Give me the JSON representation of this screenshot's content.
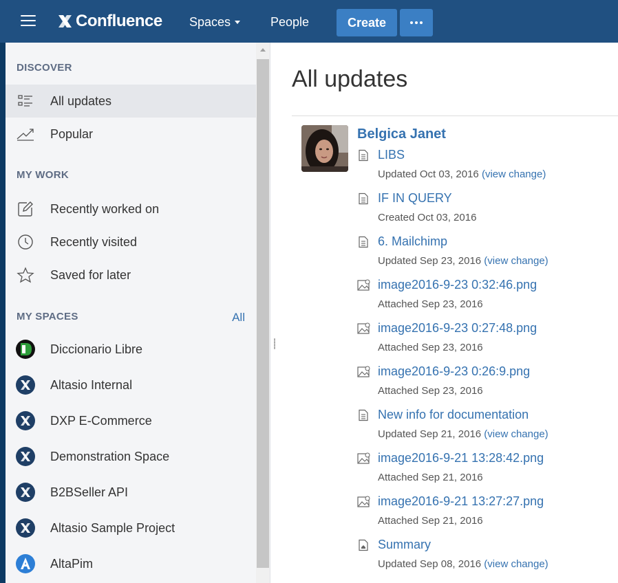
{
  "nav": {
    "logo_text": "Confluence",
    "spaces_label": "Spaces",
    "people_label": "People",
    "create_label": "Create",
    "more_icon": "ellipsis-icon",
    "colors": {
      "bar": "#205081",
      "button": "#3b7fc4"
    }
  },
  "sidebar": {
    "discover_heading": "DISCOVER",
    "discover": [
      {
        "label": "All updates",
        "icon": "list-icon",
        "active": true
      },
      {
        "label": "Popular",
        "icon": "trend-icon"
      }
    ],
    "mywork_heading": "MY WORK",
    "mywork": [
      {
        "label": "Recently worked on",
        "icon": "edit-icon"
      },
      {
        "label": "Recently visited",
        "icon": "clock-icon"
      },
      {
        "label": "Saved for later",
        "icon": "star-icon"
      }
    ],
    "myspaces_heading": "MY SPACES",
    "myspaces_all": "All",
    "spaces": [
      {
        "label": "Diccionario Libre",
        "icon": "diccionario-space-icon"
      },
      {
        "label": "Altasio Internal",
        "icon": "altasio-space-icon"
      },
      {
        "label": "DXP E-Commerce",
        "icon": "altasio-space-icon"
      },
      {
        "label": "Demonstration Space",
        "icon": "altasio-space-icon"
      },
      {
        "label": "B2BSeller API",
        "icon": "altasio-space-icon"
      },
      {
        "label": "Altasio Sample Project",
        "icon": "altasio-space-icon"
      },
      {
        "label": "AltaPim",
        "icon": "altapim-space-icon"
      }
    ]
  },
  "main": {
    "title": "All updates",
    "author": "Belgica Janet",
    "updates": [
      {
        "title": "LIBS",
        "type": "page",
        "action": "Updated Oct 03, 2016",
        "view_change": "(view change)"
      },
      {
        "title": "IF IN QUERY",
        "type": "page",
        "action": "Created Oct 03, 2016",
        "view_change": ""
      },
      {
        "title": "6. Mailchimp",
        "type": "page",
        "action": "Updated Sep 23, 2016",
        "view_change": "(view change)"
      },
      {
        "title": "image2016-9-23 0:32:46.png",
        "type": "image",
        "action": "Attached Sep 23, 2016",
        "view_change": ""
      },
      {
        "title": "image2016-9-23 0:27:48.png",
        "type": "image",
        "action": "Attached Sep 23, 2016",
        "view_change": ""
      },
      {
        "title": "image2016-9-23 0:26:9.png",
        "type": "image",
        "action": "Attached Sep 23, 2016",
        "view_change": ""
      },
      {
        "title": "New info for documentation",
        "type": "page",
        "action": "Updated Sep 21, 2016",
        "view_change": "(view change)"
      },
      {
        "title": "image2016-9-21 13:28:42.png",
        "type": "image",
        "action": "Attached Sep 21, 2016",
        "view_change": ""
      },
      {
        "title": "image2016-9-21 13:27:27.png",
        "type": "image",
        "action": "Attached Sep 21, 2016",
        "view_change": ""
      },
      {
        "title": "Summary",
        "type": "home",
        "action": "Updated Sep 08, 2016",
        "view_change": "(view change)"
      }
    ]
  }
}
